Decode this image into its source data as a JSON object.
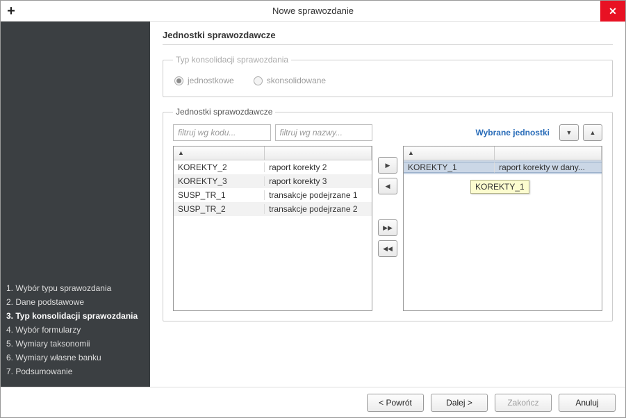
{
  "window": {
    "title": "Nowe sprawozdanie"
  },
  "sidebar": {
    "steps": [
      "1. Wybór typu sprawozdania",
      "2. Dane podstawowe",
      "3. Typ konsolidacji sprawozdania",
      "4. Wybór formularzy",
      "5. Wymiary taksonomii",
      "6. Wymiary własne banku",
      "7. Podsumowanie"
    ],
    "active_index": 2
  },
  "main": {
    "heading": "Jednostki sprawozdawcze",
    "fieldset_consolidation": {
      "legend": "Typ konsolidacji sprawozdania",
      "options": {
        "single": "jednostkowe",
        "consolidated": "skonsolidowane"
      },
      "selected": "single",
      "disabled": true
    },
    "fieldset_units": {
      "legend": "Jednostki sprawozdawcze",
      "filter_code_placeholder": "filtruj wg kodu...",
      "filter_name_placeholder": "filtruj wg nazwy...",
      "selected_label": "Wybrane jednostki",
      "available": [
        {
          "code": "KOREKTY_2",
          "name": "raport korekty 2"
        },
        {
          "code": "KOREKTY_3",
          "name": "raport korekty 3"
        },
        {
          "code": "SUSP_TR_1",
          "name": "transakcje podejrzane 1"
        },
        {
          "code": "SUSP_TR_2",
          "name": "transakcje podejrzane 2"
        }
      ],
      "selected_units": [
        {
          "code": "KOREKTY_1",
          "name": "raport korekty w dany..."
        }
      ],
      "tooltip": "KOREKTY_1",
      "sort_indicator": "▲"
    }
  },
  "footer": {
    "back": "< Powrót",
    "next": "Dalej >",
    "finish": "Zakończ",
    "cancel": "Anuluj"
  },
  "icons": {
    "move_right": "▶",
    "move_left": "◀",
    "move_all_right": "▶▶",
    "move_all_left": "◀◀",
    "sort_desc": "▼",
    "sort_asc": "▲",
    "close": "✕"
  }
}
